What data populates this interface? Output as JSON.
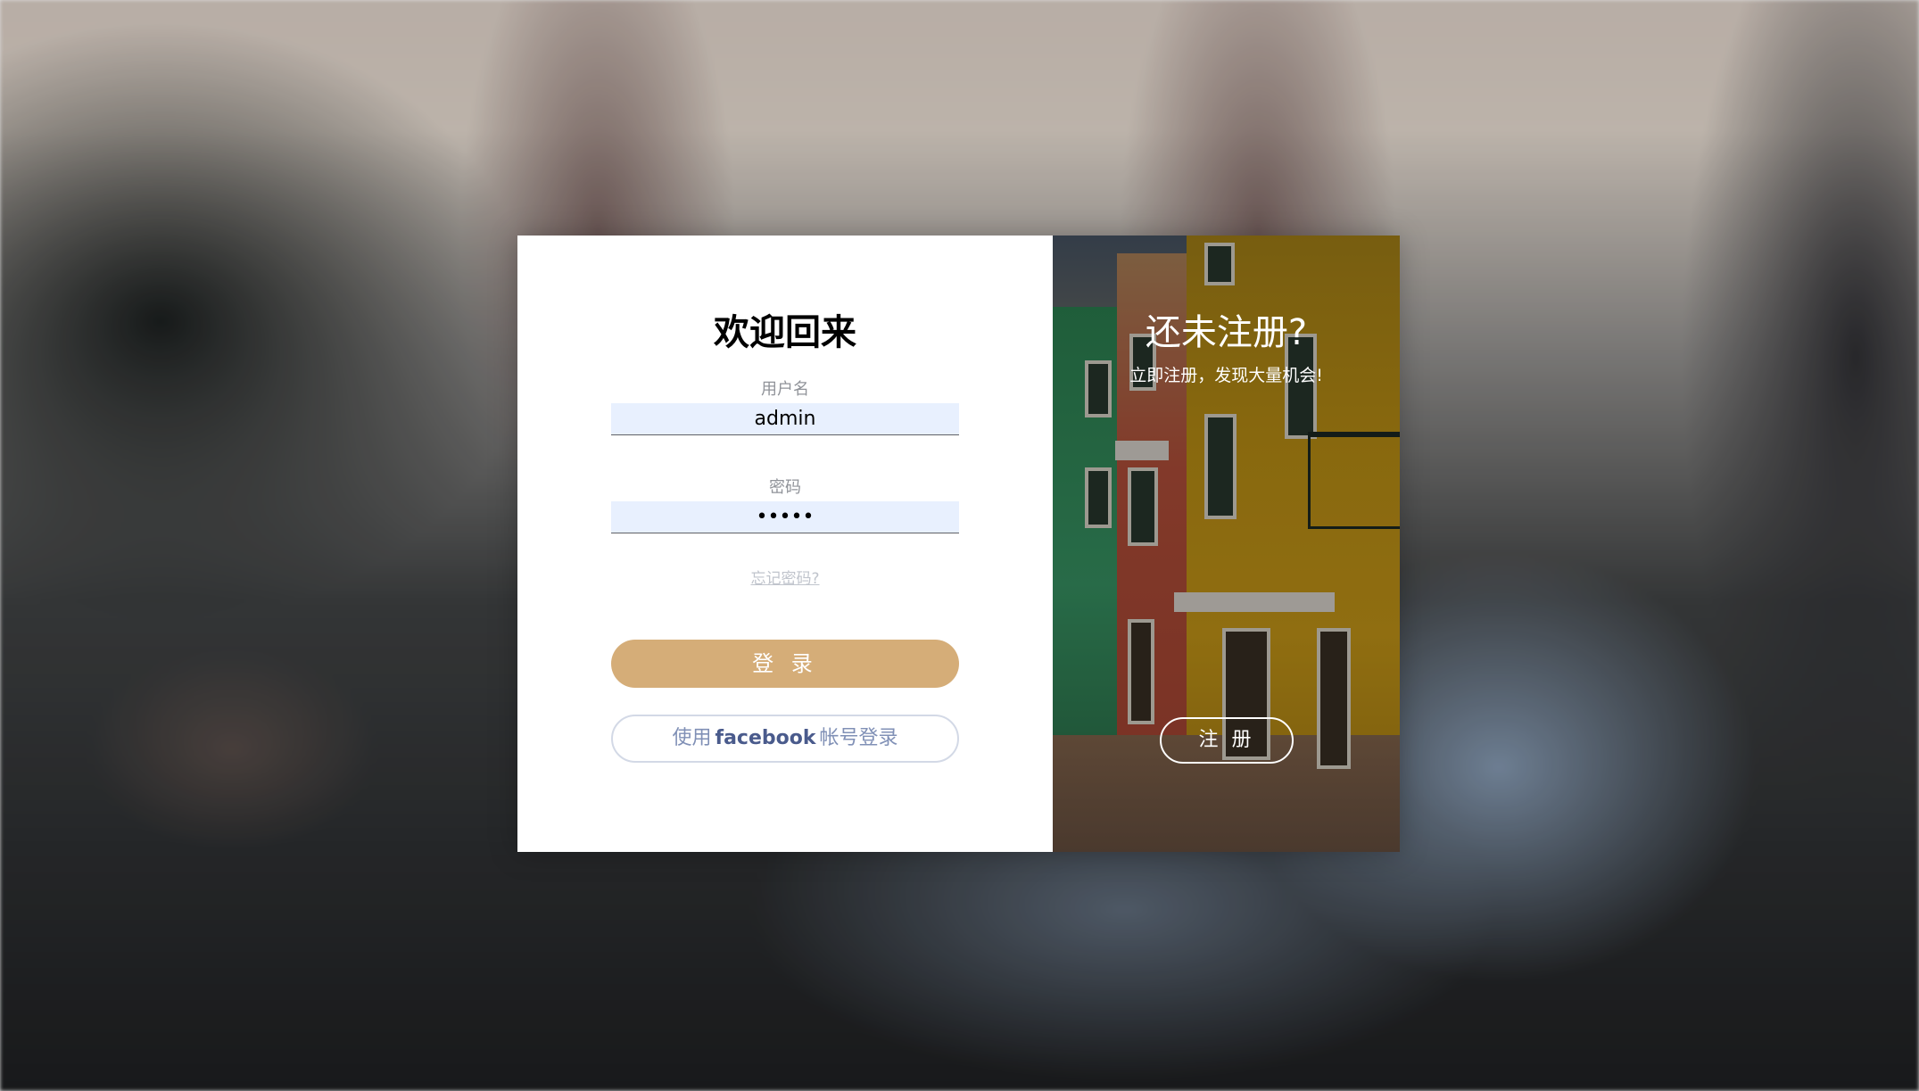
{
  "login": {
    "title": "欢迎回来",
    "username_label": "用户名",
    "username_value": "admin",
    "password_label": "密码",
    "password_value": "•••••",
    "forgot_link": "忘记密码?",
    "login_button": "登 录",
    "facebook_button_prefix": "使用",
    "facebook_button_brand": "facebook",
    "facebook_button_suffix": "帐号登录"
  },
  "promo": {
    "title": "还未注册?",
    "subtitle": "立即注册，发现大量机会!",
    "register_button": "注 册"
  },
  "colors": {
    "accent": "#d5ad78",
    "facebook_text": "#8090b6",
    "facebook_brand": "#4a5b8c",
    "input_bg": "#e8f0fe"
  }
}
